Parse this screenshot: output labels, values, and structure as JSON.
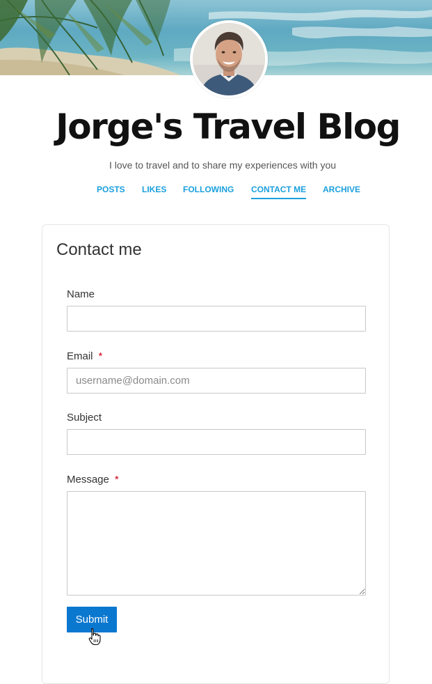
{
  "blog": {
    "title": "Jorge's Travel Blog",
    "tagline": "I love to travel and to share my experiences with you"
  },
  "nav": {
    "items": [
      "POSTS",
      "LIKES",
      "FOLLOWING",
      "CONTACT ME",
      "ARCHIVE"
    ],
    "active": "CONTACT ME"
  },
  "form": {
    "title": "Contact me",
    "name_label": "Name",
    "email_label": "Email",
    "email_placeholder": "username@domain.com",
    "subject_label": "Subject",
    "message_label": "Message",
    "required_marker": "*",
    "submit_label": "Submit"
  },
  "colors": {
    "accent": "#1ba0dd",
    "button": "#0b78d0",
    "required": "#d0021b"
  },
  "icons": {
    "cursor": "hand-pointer-icon"
  }
}
